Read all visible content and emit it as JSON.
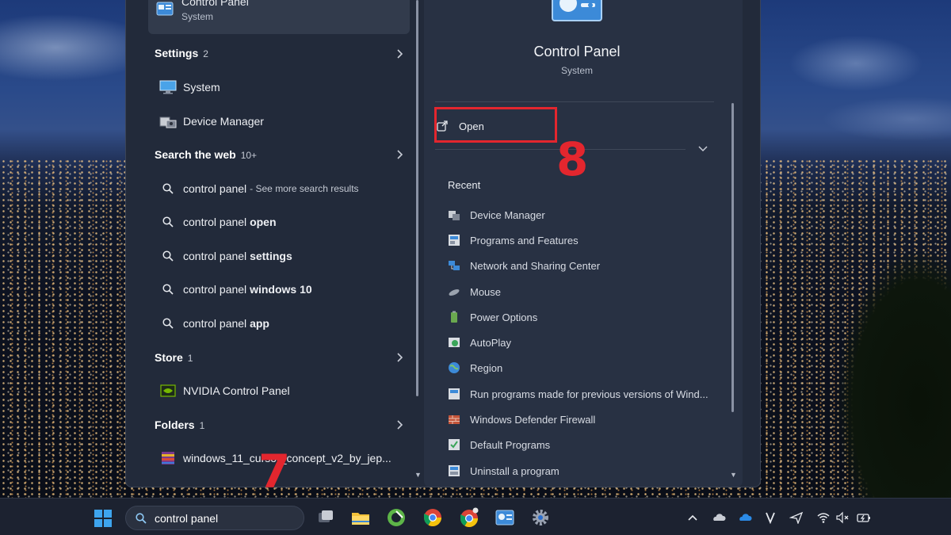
{
  "search_panel": {
    "top_result": {
      "title": "Control Panel",
      "subtitle": "System"
    },
    "sections": {
      "settings": {
        "label": "Settings",
        "count": "2"
      },
      "web": {
        "label": "Search the web",
        "count": "10+"
      },
      "store": {
        "label": "Store",
        "count": "1"
      },
      "folders": {
        "label": "Folders",
        "count": "1"
      }
    },
    "settings_items": [
      "System",
      "Device Manager"
    ],
    "web_items": [
      {
        "query": "control panel",
        "suffix": "- See more search results"
      },
      {
        "query": "control panel ",
        "bold": "open"
      },
      {
        "query": "control panel ",
        "bold": "settings"
      },
      {
        "query": "control panel ",
        "bold": "windows 10"
      },
      {
        "query": "control panel ",
        "bold": "app"
      }
    ],
    "store_items": [
      "NVIDIA Control Panel"
    ],
    "folder_items": [
      "windows_11_cursor_concept_v2_by_jep..."
    ]
  },
  "details": {
    "app_title": "Control Panel",
    "app_category": "System",
    "open_label": "Open",
    "recent_label": "Recent",
    "recent_items": [
      "Device Manager",
      "Programs and Features",
      "Network and Sharing Center",
      "Mouse",
      "Power Options",
      "AutoPlay",
      "Region",
      "Run programs made for previous versions of Wind...",
      "Windows Defender Firewall",
      "Default Programs",
      "Uninstall a program"
    ]
  },
  "annotations": {
    "step_seven": "7",
    "step_eight": "8",
    "highlight_color": "#e3262e"
  },
  "taskbar": {
    "search_value": "control panel",
    "pinned_apps": [
      "task-view-icon",
      "file-explorer-icon",
      "greenshot-icon",
      "chrome-icon",
      "chrome-profile-icon",
      "control-panel-icon",
      "settings-gear-icon"
    ],
    "tray_icons": [
      "chevron-up-icon",
      "onedrive-gray-icon",
      "onedrive-blue-icon",
      "vivaldi-icon",
      "navigation-icon",
      "wifi-icon",
      "speaker-muted-icon",
      "battery-charging-icon"
    ]
  },
  "colors": {
    "panel_bg": "#222a3a",
    "detail_bg": "#283143",
    "accent": "#e3262e",
    "taskbar_bg": "#1c2230"
  }
}
